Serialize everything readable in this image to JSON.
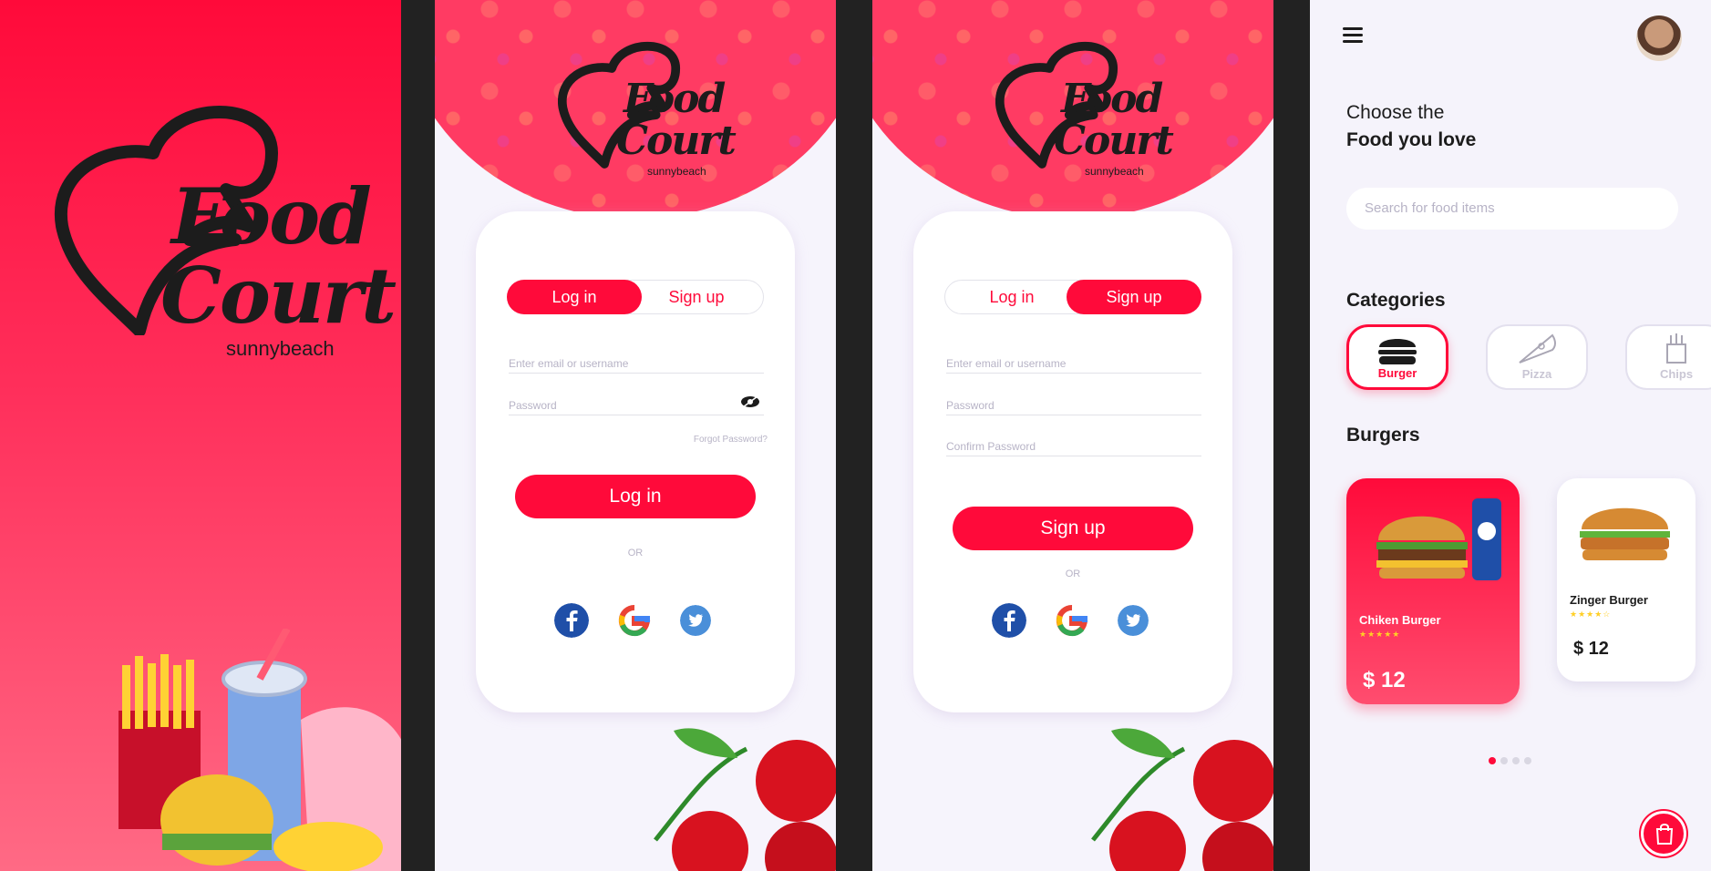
{
  "brand": {
    "word1": "Food",
    "word2": "Court",
    "word3": "sunnybeach"
  },
  "login_screen": {
    "tab_login": "Log in",
    "tab_signup": "Sign up",
    "email_placeholder": "Enter email or username",
    "password_placeholder": "Password",
    "forgot": "Forgot Password?",
    "submit": "Log in",
    "or": "OR"
  },
  "signup_screen": {
    "tab_login": "Log in",
    "tab_signup": "Sign up",
    "email_placeholder": "Enter email or username",
    "password_placeholder": "Password",
    "confirm_placeholder": "Confirm Password",
    "submit": "Sign up",
    "or": "OR"
  },
  "home": {
    "greeting_line1": "Choose the",
    "greeting_line2": "Food you love",
    "search_placeholder": "Search for food items",
    "categories_title": "Categories",
    "categories": [
      {
        "label": "Burger",
        "selected": true
      },
      {
        "label": "Pizza",
        "selected": false
      },
      {
        "label": "Chips",
        "selected": false
      }
    ],
    "section_title": "Burgers",
    "items": [
      {
        "name": "Chiken Burger",
        "stars": "★★★★★",
        "price": "$ 12"
      },
      {
        "name": "Zinger Burger",
        "stars": "★★★★☆",
        "price": "$ 12"
      }
    ],
    "carousel_active": 1,
    "carousel_count": 4
  },
  "colors": {
    "accent": "#ff0a3a",
    "text": "#1c1c1c",
    "muted": "#b7b3c6",
    "background": "#f5f3fb"
  }
}
